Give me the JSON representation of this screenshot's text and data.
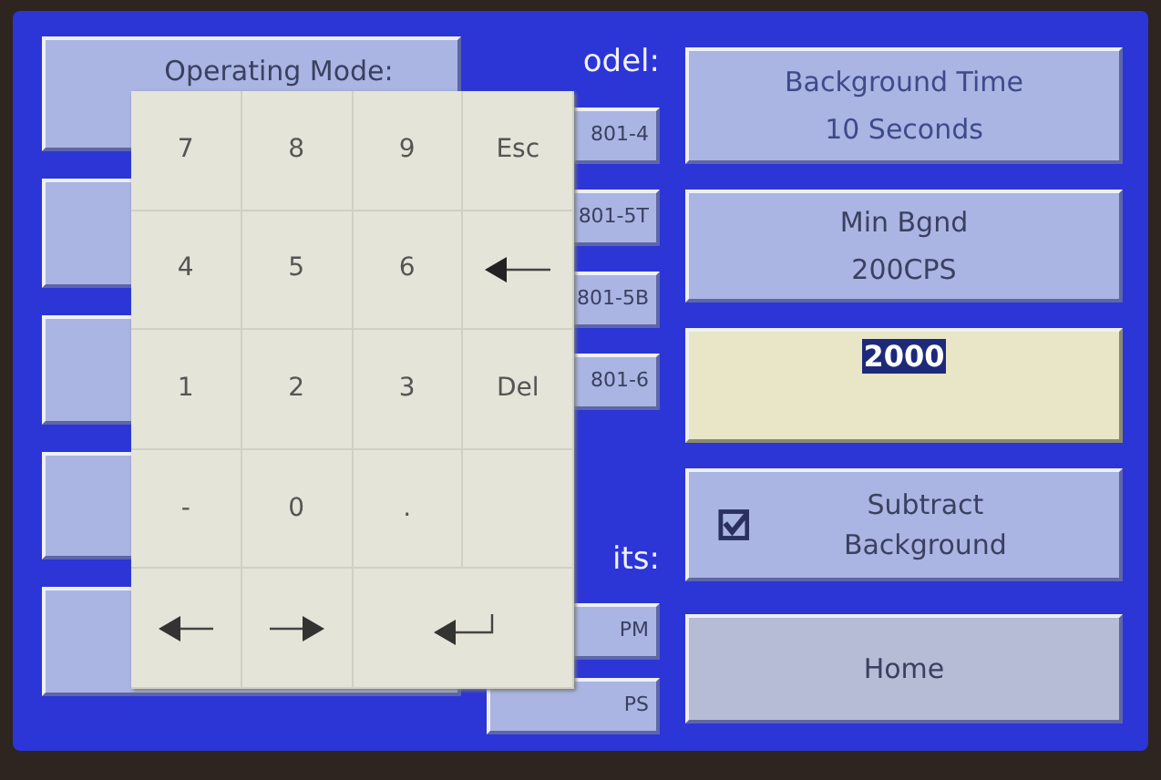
{
  "operating_mode": {
    "label": "Operating Mode:"
  },
  "model": {
    "label": "odel:",
    "options": [
      {
        "label": "801-4"
      },
      {
        "label": "801-5T"
      },
      {
        "label": "801-5B"
      },
      {
        "label": "801-6"
      }
    ]
  },
  "units": {
    "label": "its:",
    "options": [
      {
        "label": "PM"
      },
      {
        "label": "PS"
      }
    ]
  },
  "background_time": {
    "title": "Background Time",
    "value": "10 Seconds"
  },
  "min_bgnd": {
    "title": "Min Bgnd",
    "value": "200CPS"
  },
  "entry": {
    "value": "2000",
    "selected": true
  },
  "subtract_background": {
    "label": "Subtract Background",
    "checked": true
  },
  "home": {
    "label": "Home"
  },
  "keypad": [
    {
      "kind": "text",
      "label": "7"
    },
    {
      "kind": "text",
      "label": "8"
    },
    {
      "kind": "text",
      "label": "9"
    },
    {
      "kind": "text",
      "label": "Esc"
    },
    {
      "kind": "text",
      "label": "4"
    },
    {
      "kind": "text",
      "label": "5"
    },
    {
      "kind": "text",
      "label": "6"
    },
    {
      "kind": "backspace"
    },
    {
      "kind": "text",
      "label": "1"
    },
    {
      "kind": "text",
      "label": "2"
    },
    {
      "kind": "text",
      "label": "3"
    },
    {
      "kind": "text",
      "label": "Del"
    },
    {
      "kind": "text",
      "label": "-"
    },
    {
      "kind": "text",
      "label": "0"
    },
    {
      "kind": "text",
      "label": "."
    },
    {
      "kind": "blank"
    },
    {
      "kind": "left"
    },
    {
      "kind": "right"
    },
    {
      "kind": "enter"
    }
  ]
}
